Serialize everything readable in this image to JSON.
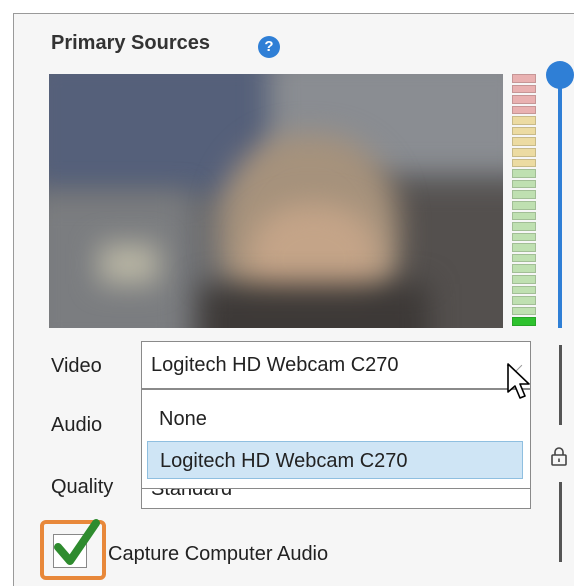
{
  "panel": {
    "title": "Primary Sources",
    "help_icon": "question-circle-icon"
  },
  "fields": {
    "video_label": "Video",
    "audio_label": "Audio",
    "quality_label": "Quality",
    "video_value": "Logitech HD Webcam C270",
    "quality_value": "Standard"
  },
  "dropdown": {
    "options": [
      "None",
      "Logitech HD Webcam C270"
    ],
    "selected": "Logitech HD Webcam C270"
  },
  "capture_audio": {
    "label": "Capture Computer Audio",
    "checked": true
  },
  "colors": {
    "accent": "#2f7fd6",
    "highlight": "#e8883a",
    "checkmark": "#2e8b2e",
    "selected_option": "#cfe5f5"
  }
}
